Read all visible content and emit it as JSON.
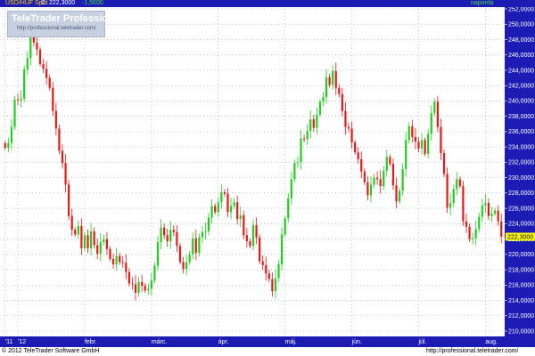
{
  "header": {
    "instrument": "USD/HUF Spot",
    "close_label": "C: 222,3000",
    "change": "-1,5600",
    "interval": "naponta"
  },
  "watermark": {
    "logo": "TeleTrader Professional",
    "url": "http://professional.teletrader.com/"
  },
  "footer": {
    "copyright": "© 2012 TeleTrader Software GmbH",
    "url": "http://professional.teletrader.com/"
  },
  "colors": {
    "titlebar": "#1c1cb4",
    "up": "#22cc22",
    "down": "#e81818",
    "axis_bg": "#1c1cb4",
    "last_price_bg": "#ffff00"
  },
  "chart_data": {
    "type": "candlestick",
    "title": "",
    "xlabel": "",
    "ylabel": "",
    "ylim": [
      210,
      252
    ],
    "y_ticks": [
      "210,0000",
      "212,0000",
      "214,0000",
      "216,0000",
      "218,0000",
      "220,0000",
      "222,0000",
      "224,0000",
      "226,0000",
      "228,0000",
      "230,0000",
      "232,0000",
      "234,0000",
      "236,0000",
      "238,0000",
      "240,0000",
      "242,0000",
      "244,0000",
      "246,0000",
      "248,0000",
      "250,0000",
      "252,0000"
    ],
    "x_ticks": [
      {
        "label": "'11",
        "index": 0
      },
      {
        "label": "'12",
        "index": 4
      },
      {
        "label": "febr.",
        "index": 25
      },
      {
        "label": "márc.",
        "index": 46
      },
      {
        "label": "ápr.",
        "index": 67
      },
      {
        "label": "máj.",
        "index": 88
      },
      {
        "label": "jún.",
        "index": 109
      },
      {
        "label": "júl.",
        "index": 130
      },
      {
        "label": "aug.",
        "index": 151
      }
    ],
    "last_price": "222,3000",
    "grid": true,
    "close": [
      233.9,
      234.5,
      236.6,
      240.2,
      240.1,
      240.3,
      244.1,
      245.6,
      249.2,
      247.6,
      246.7,
      244.8,
      244.2,
      243.0,
      241.7,
      238.7,
      236.4,
      233.5,
      231.9,
      229.1,
      225.0,
      223.2,
      222.6,
      223.7,
      220.8,
      222.5,
      220.8,
      223.0,
      221.2,
      220.1,
      221.6,
      222.0,
      220.7,
      219.4,
      218.7,
      219.8,
      219.0,
      218.9,
      217.7,
      216.2,
      216.1,
      215.0,
      216.4,
      215.9,
      215.3,
      215.5,
      216.6,
      218.5,
      221.6,
      223.5,
      222.5,
      221.7,
      223.2,
      222.9,
      221.1,
      219.0,
      218.1,
      219.0,
      220.0,
      222.1,
      220.2,
      222.2,
      222.9,
      223.0,
      224.8,
      226.3,
      225.5,
      226.8,
      228.1,
      227.9,
      225.5,
      226.3,
      226.8,
      224.6,
      225.1,
      222.5,
      221.7,
      221.1,
      223.8,
      222.2,
      219.1,
      218.6,
      217.5,
      216.8,
      215.2,
      216.9,
      218.7,
      222.6,
      224.7,
      227.3,
      229.8,
      231.9,
      232.0,
      235.1,
      235.0,
      236.1,
      237.6,
      236.5,
      238.2,
      239.9,
      240.5,
      243.1,
      242.1,
      243.9,
      241.7,
      240.9,
      238.7,
      236.6,
      236.4,
      234.6,
      233.3,
      232.4,
      230.8,
      229.4,
      227.7,
      229.1,
      230.0,
      229.8,
      228.9,
      230.9,
      232.7,
      231.8,
      229.0,
      226.9,
      228.3,
      231.1,
      234.9,
      236.7,
      235.3,
      234.7,
      233.8,
      234.9,
      233.1,
      235.7,
      238.4,
      239.9,
      236.6,
      233.2,
      230.5,
      226.1,
      226.7,
      228.5,
      229.8,
      228.9,
      224.3,
      223.6,
      222.0,
      222.1,
      223.3,
      224.9,
      226.4,
      226.7,
      225.0,
      225.3,
      225.7,
      224.3,
      222.3
    ]
  }
}
